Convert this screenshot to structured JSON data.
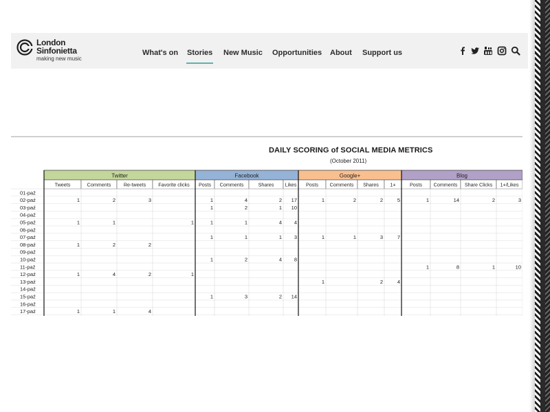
{
  "header": {
    "logo_line1": "London",
    "logo_line2": "Sinfonietta",
    "logo_tagline": "making new music",
    "nav": [
      "What's on",
      "Stories",
      "New Music",
      "Opportunities",
      "About",
      "Support us"
    ],
    "active_nav": "Stories",
    "social_icons": [
      "facebook-icon",
      "twitter-icon",
      "youtube-icon",
      "instagram-icon",
      "search-icon"
    ]
  },
  "colors": {
    "twitter": "#c4d79b",
    "facebook": "#95b3d7",
    "googleplus": "#fabf8f",
    "blog": "#b1a0c7",
    "accent": "#5fb1a9"
  },
  "sheet": {
    "title": "DAILY SCORING of SOCIAL MEDIA METRICS",
    "subtitle": "(October 2011)",
    "groups": [
      {
        "name": "Twitter",
        "color_key": "twitter",
        "columns": [
          "Tweets",
          "Comments",
          "Re-tweets",
          "Favorite clicks"
        ]
      },
      {
        "name": "Facebook",
        "color_key": "facebook",
        "columns": [
          "Posts",
          "Comments",
          "Shares",
          "Likes"
        ]
      },
      {
        "name": "Google+",
        "color_key": "googleplus",
        "columns": [
          "Posts",
          "Comments",
          "Shares",
          "1+"
        ]
      },
      {
        "name": "Blog",
        "color_key": "blog",
        "columns": [
          "Posts",
          "Comments",
          "Share Clicks",
          "1+/Likes"
        ]
      }
    ],
    "rows": [
      {
        "date": "01-paź",
        "values": [
          "",
          "",
          "",
          "",
          "",
          "",
          "",
          "",
          "",
          "",
          "",
          "",
          "",
          "",
          "",
          ""
        ]
      },
      {
        "date": "02-paź",
        "values": [
          "1",
          "2",
          "3",
          "",
          "1",
          "4",
          "2",
          "17",
          "1",
          "2",
          "2",
          "5",
          "1",
          "14",
          "2",
          "3"
        ]
      },
      {
        "date": "03-paź",
        "values": [
          "",
          "",
          "",
          "",
          "1",
          "2",
          "1",
          "10",
          "",
          "",
          "",
          "",
          "",
          "",
          "",
          ""
        ]
      },
      {
        "date": "04-paź",
        "values": [
          "",
          "",
          "",
          "",
          "",
          "",
          "",
          "",
          "",
          "",
          "",
          "",
          "",
          "",
          "",
          ""
        ]
      },
      {
        "date": "05-paź",
        "values": [
          "1",
          "1",
          "",
          "1",
          "1",
          "1",
          "4",
          "4",
          "",
          "",
          "",
          "",
          "",
          "",
          "",
          ""
        ]
      },
      {
        "date": "06-paź",
        "values": [
          "",
          "",
          "",
          "",
          "",
          "",
          "",
          "",
          "",
          "",
          "",
          "",
          "",
          "",
          "",
          ""
        ]
      },
      {
        "date": "07-paź",
        "values": [
          "",
          "",
          "",
          "",
          "1",
          "1",
          "1",
          "3",
          "1",
          "1",
          "3",
          "7",
          "",
          "",
          "",
          ""
        ]
      },
      {
        "date": "08-paź",
        "values": [
          "1",
          "2",
          "2",
          "",
          "",
          "",
          "",
          "",
          "",
          "",
          "",
          "",
          "",
          "",
          "",
          ""
        ]
      },
      {
        "date": "09-paź",
        "values": [
          "",
          "",
          "",
          "",
          "",
          "",
          "",
          "",
          "",
          "",
          "",
          "",
          "",
          "",
          "",
          ""
        ]
      },
      {
        "date": "10-paź",
        "values": [
          "",
          "",
          "",
          "",
          "1",
          "2",
          "4",
          "8",
          "",
          "",
          "",
          "",
          "",
          "",
          "",
          ""
        ]
      },
      {
        "date": "11-paź",
        "values": [
          "",
          "",
          "",
          "",
          "",
          "",
          "",
          "",
          "",
          "",
          "",
          "",
          "1",
          "8",
          "1",
          "10"
        ]
      },
      {
        "date": "12-paź",
        "values": [
          "1",
          "4",
          "2",
          "1",
          "",
          "",
          "",
          "",
          "",
          "",
          "",
          "",
          "",
          "",
          "",
          ""
        ]
      },
      {
        "date": "13-paź",
        "values": [
          "",
          "",
          "",
          "",
          "",
          "",
          "",
          "",
          "1",
          "",
          "2",
          "4",
          "",
          "",
          "",
          ""
        ]
      },
      {
        "date": "14-paź",
        "values": [
          "",
          "",
          "",
          "",
          "",
          "",
          "",
          "",
          "",
          "",
          "",
          "",
          "",
          "",
          "",
          ""
        ]
      },
      {
        "date": "15-paź",
        "values": [
          "",
          "",
          "",
          "",
          "1",
          "3",
          "2",
          "14",
          "",
          "",
          "",
          "",
          "",
          "",
          "",
          ""
        ]
      },
      {
        "date": "16-paź",
        "values": [
          "",
          "",
          "",
          "",
          "",
          "",
          "",
          "",
          "",
          "",
          "",
          "",
          "",
          "",
          "",
          ""
        ]
      },
      {
        "date": "17-paź",
        "values": [
          "1",
          "1",
          "4",
          "",
          "",
          "",
          "",
          "",
          "",
          "",
          "",
          "",
          "",
          "",
          "",
          ""
        ]
      }
    ]
  }
}
